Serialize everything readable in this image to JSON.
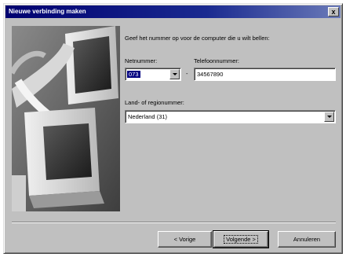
{
  "window": {
    "title": "Nieuwe verbinding maken",
    "close_label": "x"
  },
  "content": {
    "instruction": "Geef het nummer op voor de computer die u wilt bellen:"
  },
  "area_code": {
    "label": "Netnummer:",
    "value": "073"
  },
  "phone_number": {
    "separator": "-",
    "label": "Telefoonnummer:",
    "value": "34567890"
  },
  "country": {
    "label": "Land- of regionummer:",
    "value": "Nederland (31)"
  },
  "buttons": {
    "back": "< Vorige",
    "next": "Volgende >",
    "cancel": "Annuleren"
  },
  "colors": {
    "titlebar": "#000070",
    "dialog_face": "#c0c0c0",
    "selection": "#000080"
  }
}
